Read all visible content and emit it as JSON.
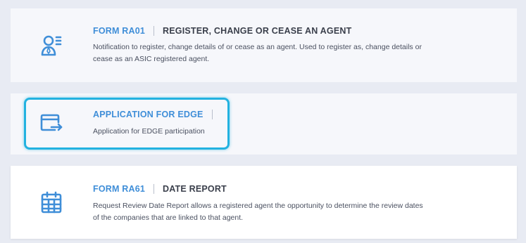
{
  "colors": {
    "accent": "#3f8ed8",
    "highlight": "#23b2e0",
    "background": "#e8ebf3"
  },
  "forms": [
    {
      "code": "FORM RA01",
      "name": "REGISTER, CHANGE OR CEASE AN AGENT",
      "description": "Notification to register, change details of or cease as an agent. Used to register as, change details or cease as an ASIC registered agent.",
      "icon": "agent-person-icon"
    },
    {
      "code": "",
      "name": "APPLICATION FOR EDGE",
      "description": "Application for EDGE participation",
      "icon": "card-transfer-icon"
    },
    {
      "code": "FORM RA61",
      "name": "DATE REPORT",
      "description": "Request Review Date Report allows a registered agent the opportunity to determine the review dates of the companies that are linked to that agent.",
      "icon": "calendar-icon"
    }
  ]
}
